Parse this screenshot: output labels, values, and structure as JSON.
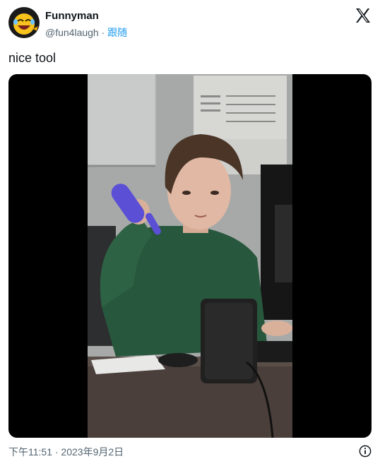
{
  "user": {
    "name": "Funnyman",
    "handle": "@fun4laugh",
    "separator": "·",
    "follow_label": "跟随"
  },
  "tweet": {
    "text": "nice tool",
    "timestamp": "下午11:51 · 2023年9月2日"
  },
  "icons": {
    "brand": "x-logo-icon",
    "avatar": "laughing-emoji-icon",
    "info": "info-icon"
  },
  "colors": {
    "link": "#1d9bf0",
    "secondary_text": "#536471",
    "hoodie": "#27573c",
    "toy": "#5b4fd6"
  }
}
